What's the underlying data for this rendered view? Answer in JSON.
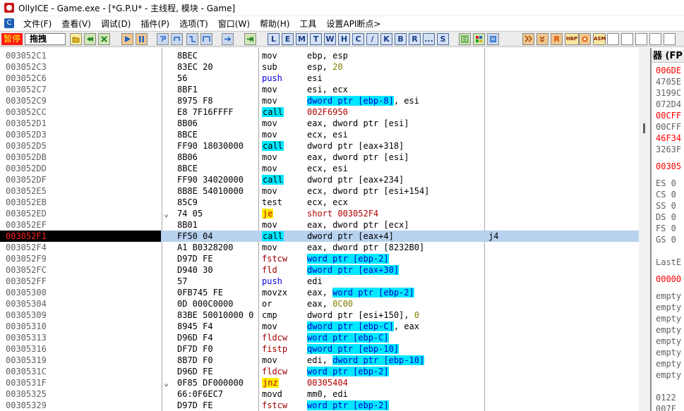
{
  "window": {
    "title": "OllyICE - Game.exe - [*G.P.U* - 主线程, 模块 - Game]"
  },
  "menu": {
    "items": [
      {
        "label": "文件(F)"
      },
      {
        "label": "查看(V)"
      },
      {
        "label": "调试(D)"
      },
      {
        "label": "插件(P)"
      },
      {
        "label": "选项(T)"
      },
      {
        "label": "窗口(W)"
      },
      {
        "label": "帮助(H)"
      },
      {
        "label": "工具"
      },
      {
        "label": "设置API断点>"
      }
    ]
  },
  "toolbar": {
    "status": "暂停",
    "status_box": "拖拽",
    "letter_buttons": [
      "L",
      "E",
      "M",
      "T",
      "W",
      "H",
      "C",
      "/",
      "K",
      "B",
      "R",
      "...",
      "S"
    ],
    "tag_buttons": [
      "HBP",
      "ASM"
    ]
  },
  "disasm": {
    "rows": [
      {
        "addr": "003052C1",
        "mark": "",
        "hex": "8BEC",
        "mnem": "mov",
        "op": "ebp, esp",
        "comment": ""
      },
      {
        "addr": "003052C3",
        "mark": "",
        "hex": "83EC 20",
        "mnem": "sub",
        "op": "esp, 20",
        "comment": ""
      },
      {
        "addr": "003052C6",
        "mark": "",
        "hex": "56",
        "mnem": "push",
        "op": "esi",
        "comment": ""
      },
      {
        "addr": "003052C7",
        "mark": "",
        "hex": "8BF1",
        "mnem": "mov",
        "op": "esi, ecx",
        "comment": ""
      },
      {
        "addr": "003052C9",
        "mark": "",
        "hex": "8975 F8",
        "mnem": "mov",
        "op": "dword ptr [ebp-8], esi",
        "comment": ""
      },
      {
        "addr": "003052CC",
        "mark": "",
        "hex": "E8 7F16FFFF",
        "mnem": "call",
        "op": "002F6950",
        "comment": ""
      },
      {
        "addr": "003052D1",
        "mark": "",
        "hex": "8B06",
        "mnem": "mov",
        "op": "eax, dword ptr [esi]",
        "comment": ""
      },
      {
        "addr": "003052D3",
        "mark": "",
        "hex": "8BCE",
        "mnem": "mov",
        "op": "ecx, esi",
        "comment": ""
      },
      {
        "addr": "003052D5",
        "mark": "",
        "hex": "FF90 18030000",
        "mnem": "call",
        "op": "dword ptr [eax+318]",
        "comment": ""
      },
      {
        "addr": "003052DB",
        "mark": "",
        "hex": "8B06",
        "mnem": "mov",
        "op": "eax, dword ptr [esi]",
        "comment": ""
      },
      {
        "addr": "003052DD",
        "mark": "",
        "hex": "8BCE",
        "mnem": "mov",
        "op": "ecx, esi",
        "comment": ""
      },
      {
        "addr": "003052DF",
        "mark": "",
        "hex": "FF90 34020000",
        "mnem": "call",
        "op": "dword ptr [eax+234]",
        "comment": ""
      },
      {
        "addr": "003052E5",
        "mark": "",
        "hex": "8B8E 54010000",
        "mnem": "mov",
        "op": "ecx, dword ptr [esi+154]",
        "comment": ""
      },
      {
        "addr": "003052EB",
        "mark": "",
        "hex": "85C9",
        "mnem": "test",
        "op": "ecx, ecx",
        "comment": ""
      },
      {
        "addr": "003052ED",
        "mark": "⌄",
        "hex": "74 05",
        "mnem": "je",
        "op": "short 003052F4",
        "comment": ""
      },
      {
        "addr": "003052EF",
        "mark": "",
        "hex": "8B01",
        "mnem": "mov",
        "op": "eax, dword ptr [ecx]",
        "comment": ""
      },
      {
        "addr": "003052F1",
        "mark": "",
        "hex": "FF50 04",
        "mnem": "call",
        "op": "dword ptr [eax+4]",
        "comment": "j4"
      },
      {
        "addr": "003052F4",
        "mark": "",
        "hex": "A1 B0328200",
        "mnem": "mov",
        "op": "eax, dword ptr [8232B0]",
        "comment": ""
      },
      {
        "addr": "003052F9",
        "mark": "",
        "hex": "D97D FE",
        "mnem": "fstcw",
        "op": "word ptr [ebp-2]",
        "comment": ""
      },
      {
        "addr": "003052FC",
        "mark": "",
        "hex": "D940 30",
        "mnem": "fld",
        "op": "dword ptr [eax+30]",
        "comment": ""
      },
      {
        "addr": "003052FF",
        "mark": "",
        "hex": "57",
        "mnem": "push",
        "op": "edi",
        "comment": ""
      },
      {
        "addr": "00305300",
        "mark": "",
        "hex": "0FB745 FE",
        "mnem": "movzx",
        "op": "eax, word ptr [ebp-2]",
        "comment": ""
      },
      {
        "addr": "00305304",
        "mark": "",
        "hex": "0D 000C0000",
        "mnem": "or",
        "op": "eax, 0C00",
        "comment": ""
      },
      {
        "addr": "00305309",
        "mark": "",
        "hex": "83BE 50010000 0",
        "mnem": "cmp",
        "op": "dword ptr [esi+150], 0",
        "comment": ""
      },
      {
        "addr": "00305310",
        "mark": "",
        "hex": "8945 F4",
        "mnem": "mov",
        "op": "dword ptr [ebp-C], eax",
        "comment": ""
      },
      {
        "addr": "00305313",
        "mark": "",
        "hex": "D96D F4",
        "mnem": "fldcw",
        "op": "word ptr [ebp-C]",
        "comment": ""
      },
      {
        "addr": "00305316",
        "mark": "",
        "hex": "DF7D F0",
        "mnem": "fistp",
        "op": "qword ptr [ebp-10]",
        "comment": ""
      },
      {
        "addr": "00305319",
        "mark": "",
        "hex": "8B7D F0",
        "mnem": "mov",
        "op": "edi, dword ptr [ebp-10]",
        "comment": ""
      },
      {
        "addr": "0030531C",
        "mark": "",
        "hex": "D96D FE",
        "mnem": "fldcw",
        "op": "word ptr [ebp-2]",
        "comment": ""
      },
      {
        "addr": "0030531F",
        "mark": "⌄",
        "hex": "0F85 DF000000",
        "mnem": "jnz",
        "op": "00305404",
        "comment": ""
      },
      {
        "addr": "00305325",
        "mark": "",
        "hex": "66:0F6EC7",
        "mnem": "movd",
        "op": "mm0, edi",
        "comment": ""
      },
      {
        "addr": "00305329",
        "mark": "",
        "hex": "D97D FE",
        "mnem": "fstcw",
        "op": "word ptr [ebp-2]",
        "comment": ""
      }
    ]
  },
  "registers": {
    "header": "器 (FP",
    "lines": [
      {
        "text": "006DE",
        "style": "red"
      },
      {
        "text": "4705E",
        "style": "gray"
      },
      {
        "text": "3199C",
        "style": "gray"
      },
      {
        "text": "072D4",
        "style": "gray"
      },
      {
        "text": "00CFF",
        "style": "red"
      },
      {
        "text": "00CFF",
        "style": "gray"
      },
      {
        "text": "46F34",
        "style": "red"
      },
      {
        "text": "3263F",
        "style": "gray"
      },
      {
        "text": "00305",
        "style": "red"
      },
      {
        "text": "ES 0",
        "style": "gray"
      },
      {
        "text": "CS 0",
        "style": "gray"
      },
      {
        "text": "SS 0",
        "style": "gray"
      },
      {
        "text": "DS 0",
        "style": "gray"
      },
      {
        "text": "FS 0",
        "style": "gray"
      },
      {
        "text": "GS 0",
        "style": "gray"
      },
      {
        "text": "LastE",
        "style": "gray"
      },
      {
        "text": "00000",
        "style": "red"
      },
      {
        "text": "empty",
        "style": "gray"
      },
      {
        "text": "empty",
        "style": "gray"
      },
      {
        "text": "empty",
        "style": "gray"
      },
      {
        "text": "empty",
        "style": "gray"
      },
      {
        "text": "empty",
        "style": "gray"
      },
      {
        "text": "empty",
        "style": "gray"
      },
      {
        "text": "empty",
        "style": "gray"
      },
      {
        "text": "empty",
        "style": "gray"
      },
      {
        "text": "0122",
        "style": "gray"
      },
      {
        "text": "007F",
        "style": "gray"
      }
    ]
  },
  "colors": {
    "call_highlight": "#00e8ff",
    "jump_highlight": "#ffee00",
    "current_line": "#b7d1ef",
    "paused_badge": "#ff1a1a"
  }
}
